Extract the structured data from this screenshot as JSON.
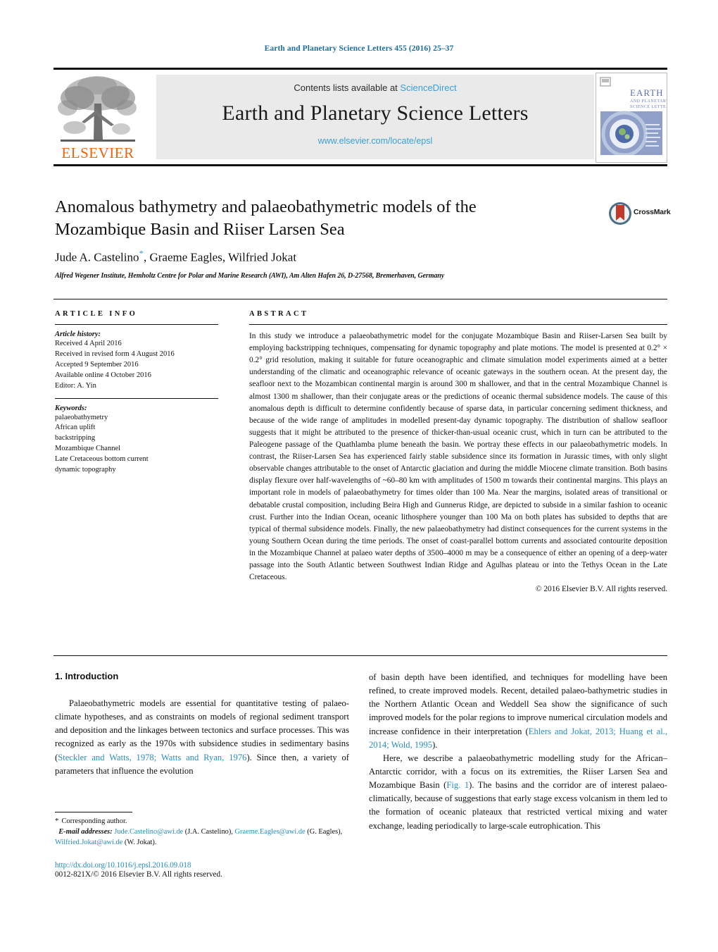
{
  "running_head": "Earth and Planetary Science Letters 455 (2016) 25–37",
  "masthead": {
    "contents_prefix": "Contents lists available at",
    "sciencedirect": "ScienceDirect",
    "journal_title": "Earth and Planetary Science Letters",
    "journal_url": "www.elsevier.com/locate/epsl",
    "publisher": "ELSEVIER",
    "cover_title_line1": "EARTH",
    "cover_title_line2": "AND PLANETARY",
    "cover_title_line3": "SCIENCE LETTERS"
  },
  "article": {
    "title": "Anomalous bathymetry and palaeobathymetric models of the Mozambique Basin and Riiser Larsen Sea",
    "authors_before_star": "Jude A. Castelino",
    "authors_after_star": ", Graeme Eagles, Wilfried Jokat",
    "affiliation": "Alfred Wegener Institute, Hemholtz Centre for Polar and Marine Research (AWI), Am Alten Hafen 26, D-27568, Bremerhaven, Germany",
    "crossmark_label": "CrossMark"
  },
  "info": {
    "heading": "ARTICLE INFO",
    "history_label": "Article history:",
    "history": [
      "Received 4 April 2016",
      "Received in revised form 4 August 2016",
      "Accepted 9 September 2016",
      "Available online 4 October 2016",
      "Editor: A. Yin"
    ],
    "keywords_label": "Keywords:",
    "keywords": [
      "palaeobathymetry",
      "African uplift",
      "backstripping",
      "Mozambique Channel",
      "Late Cretaceous bottom current",
      "dynamic topography"
    ]
  },
  "abstract": {
    "heading": "ABSTRACT",
    "body": "In this study we introduce a palaeobathymetric model for the conjugate Mozambique Basin and Riiser-Larsen Sea built by employing backstripping techniques, compensating for dynamic topography and plate motions. The model is presented at 0.2° × 0.2° grid resolution, making it suitable for future oceanographic and climate simulation model experiments aimed at a better understanding of the climatic and oceanographic relevance of oceanic gateways in the southern ocean. At the present day, the seafloor next to the Mozambican continental margin is around 300 m shallower, and that in the central Mozambique Channel is almost 1300 m shallower, than their conjugate areas or the predictions of oceanic thermal subsidence models. The cause of this anomalous depth is difficult to determine confidently because of sparse data, in particular concerning sediment thickness, and because of the wide range of amplitudes in modelled present-day dynamic topography. The distribution of shallow seafloor suggests that it might be attributed to the presence of thicker-than-usual oceanic crust, which in turn can be attributed to the Paleogene passage of the Quathlamba plume beneath the basin. We portray these effects in our palaeobathymetric models. In contrast, the Riiser-Larsen Sea has experienced fairly stable subsidence since its formation in Jurassic times, with only slight observable changes attributable to the onset of Antarctic glaciation and during the middle Miocene climate transition. Both basins display flexure over half-wavelengths of ~60–80 km with amplitudes of 1500 m towards their continental margins. This plays an important role in models of palaeobathymetry for times older than 100 Ma. Near the margins, isolated areas of transitional or debatable crustal composition, including Beira High and Gunnerus Ridge, are depicted to subside in a similar fashion to oceanic crust. Further into the Indian Ocean, oceanic lithosphere younger than 100 Ma on both plates has subsided to depths that are typical of thermal subsidence models. Finally, the new palaeobathymetry had distinct consequences for the current systems in the young Southern Ocean during the time periods. The onset of coast-parallel bottom currents and associated contourite deposition in the Mozambique Channel at palaeo water depths of 3500–4000 m may be a consequence of either an opening of a deep-water passage into the South Atlantic between Southwest Indian Ridge and Agulhas plateau or into the Tethys Ocean in the Late Cretaceous.",
    "copyright": "© 2016 Elsevier B.V. All rights reserved."
  },
  "body": {
    "section_heading": "1. Introduction",
    "left_para_1_a": "Palaeobathymetric models are essential for quantitative testing of palaeo-climate hypotheses, and as constraints on models of regional sediment transport and deposition and the linkages between tectonics and surface processes. This was recognized as early as the 1970s with subsidence studies in sedimentary basins (",
    "left_ref_1": "Steckler and Watts, 1978; Watts and Ryan, 1976",
    "left_para_1_b": "). Since then, a variety of parameters that influence the evolution",
    "right_para_1_a": "of basin depth have been identified, and techniques for modelling have been refined, to create improved models. Recent, detailed palaeo-bathymetric studies in the Northern Atlantic Ocean and Weddell Sea show the significance of such improved models for the polar regions to improve numerical circulation models and increase confidence in their interpretation (",
    "right_ref_1": "Ehlers and Jokat, 2013; Huang et al., 2014; Wold, 1995",
    "right_para_1_b": ").",
    "right_para_2_a": "Here, we describe a palaeobathymetric modelling study for the African–Antarctic corridor, with a focus on its extremities, the Riiser Larsen Sea and Mozambique Basin (",
    "right_ref_2": "Fig. 1",
    "right_para_2_b": "). The basins and the corridor are of interest palaeo-climatically, because of suggestions that early stage excess volcanism in them led to the formation of oceanic plateaux that restricted vertical mixing and water exchange, leading periodically to large-scale eutrophication. This"
  },
  "footnote": {
    "corresponding": "Corresponding author.",
    "email_label": "E-mail addresses:",
    "email_1": "Jude.Castelino@awi.de",
    "email_1_name": "(J.A. Castelino),",
    "email_2": "Graeme.Eagles@awi.de",
    "email_2_name": "(G. Eagles),",
    "email_3": "Wilfried.Jokat@awi.de",
    "email_3_name": "(W. Jokat).",
    "doi": "http://dx.doi.org/10.1016/j.epsl.2016.09.018",
    "issn": "0012-821X/© 2016 Elsevier B.V. All rights reserved."
  },
  "colors": {
    "link": "#2a8cc0",
    "header_blue": "#1a6d9e",
    "elsevier_orange": "#ec6608",
    "masthead_gray": "#eaeaea"
  }
}
